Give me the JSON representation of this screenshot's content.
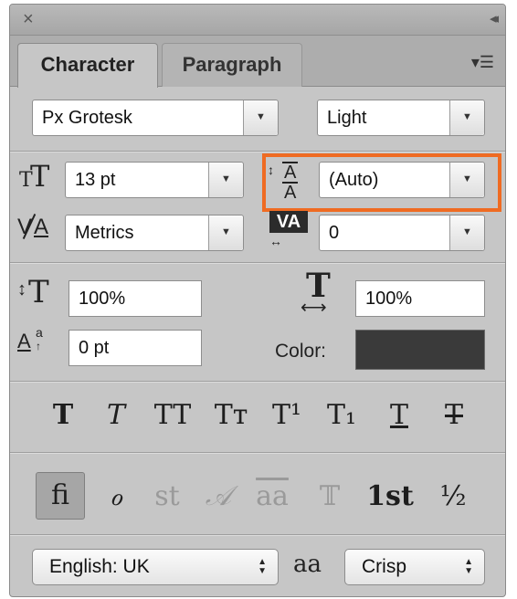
{
  "window": {
    "close_icon": "×",
    "collapse_icon": "◂◂"
  },
  "tabs": [
    {
      "label": "Character"
    },
    {
      "label": "Paragraph"
    }
  ],
  "font": {
    "family": "Px Grotesk",
    "style": "Light"
  },
  "size": {
    "value": "13 pt"
  },
  "leading": {
    "value": "(Auto)"
  },
  "kerning": {
    "value": "Metrics"
  },
  "tracking": {
    "value": "0"
  },
  "vertical_scale": {
    "value": "100%"
  },
  "horizontal_scale": {
    "value": "100%"
  },
  "baseline_shift": {
    "value": "0 pt"
  },
  "color": {
    "label": "Color:",
    "swatch": "#3a3a3a"
  },
  "highlight_color": "#ef6b22",
  "type_styles": [
    "T",
    "T",
    "TT",
    "Tт",
    "T¹",
    "T₁",
    "T",
    "T"
  ],
  "opentype": [
    "ﬁ",
    "ℴ",
    "st",
    "𝒜",
    "aa",
    "𝕋",
    "1st",
    "½"
  ],
  "language": {
    "value": "English: UK"
  },
  "aa_label": "aa",
  "antialias": {
    "value": "Crisp"
  }
}
